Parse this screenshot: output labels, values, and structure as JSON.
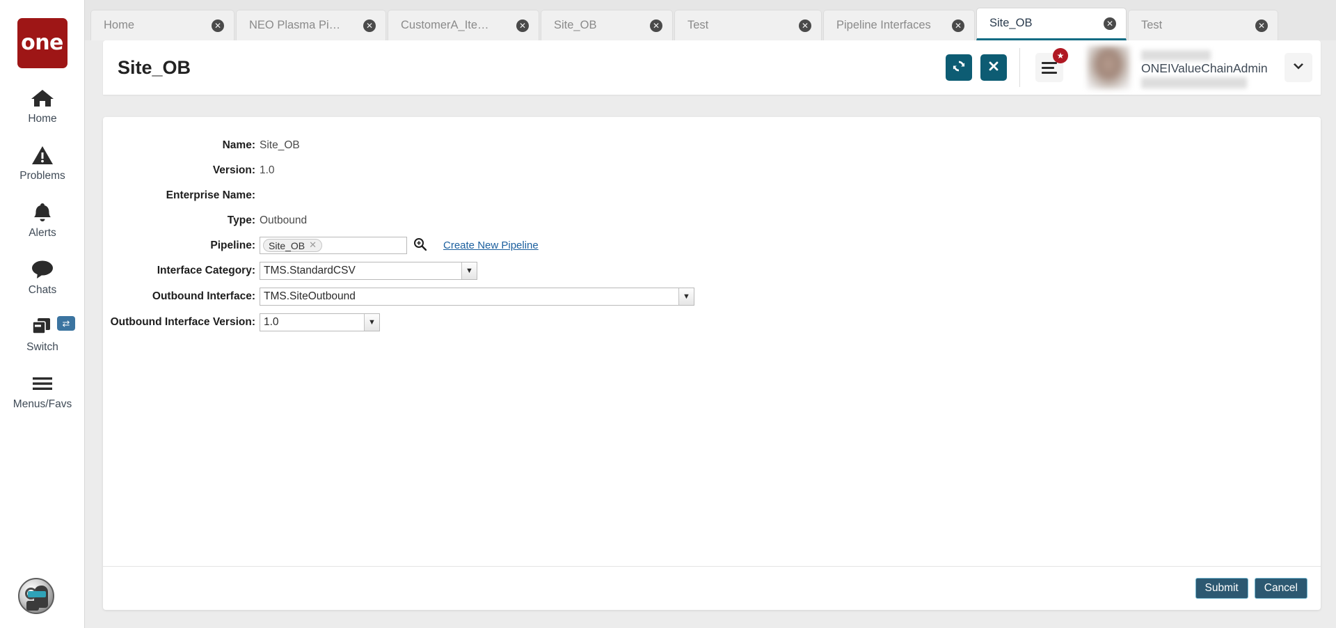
{
  "brand": {
    "logo_text": "one"
  },
  "sidebar": {
    "items": [
      {
        "label": "Home",
        "icon": "home-icon"
      },
      {
        "label": "Problems",
        "icon": "warning-triangle-icon"
      },
      {
        "label": "Alerts",
        "icon": "bell-icon"
      },
      {
        "label": "Chats",
        "icon": "chat-bubble-icon"
      },
      {
        "label": "Switch",
        "icon": "windows-stack-icon",
        "badge_icon": "swap-arrows-icon"
      },
      {
        "label": "Menus/Favs",
        "icon": "hamburger-icon"
      }
    ],
    "assistant_icon": "ai-assistant-orb-icon"
  },
  "tabs": [
    {
      "label": "Home",
      "active": false
    },
    {
      "label": "NEO Plasma Pipelines",
      "active": false
    },
    {
      "label": "CustomerA_Item_IB",
      "active": false
    },
    {
      "label": "Site_OB",
      "active": false
    },
    {
      "label": "Test",
      "active": false
    },
    {
      "label": "Pipeline Interfaces",
      "active": false
    },
    {
      "label": "Site_OB",
      "active": true
    },
    {
      "label": "Test",
      "active": false
    }
  ],
  "header": {
    "title": "Site_OB",
    "refresh_icon": "refresh-icon",
    "close_icon": "close-x-icon",
    "menu_icon": "hamburger-menu-icon",
    "favorite_badge_icon": "star-badge-icon",
    "avatar_icon": "user-avatar",
    "username": "ONEIValueChainAdmin",
    "chevron_icon": "chevron-down-icon"
  },
  "form": {
    "rows": [
      {
        "label": "Name:",
        "value": "Site_OB"
      },
      {
        "label": "Version:",
        "value": "1.0"
      },
      {
        "label": "Enterprise Name:",
        "value": ""
      },
      {
        "label": "Type:",
        "value": "Outbound"
      }
    ],
    "pipeline": {
      "label": "Pipeline:",
      "token": "Site_OB",
      "token_remove_icon": "remove-x-icon",
      "search_icon": "search-magnifier-icon",
      "link": "Create New Pipeline"
    },
    "interface_category": {
      "label": "Interface Category:",
      "value": "TMS.StandardCSV"
    },
    "outbound_interface": {
      "label": "Outbound Interface:",
      "value": "TMS.SiteOutbound"
    },
    "outbound_interface_version": {
      "label": "Outbound Interface Version:",
      "value": "1.0"
    }
  },
  "footer": {
    "submit_label": "Submit",
    "cancel_label": "Cancel"
  },
  "colors": {
    "brand_red": "#9e1616",
    "teal_button": "#0d5c73",
    "active_tab_underline": "#0f6b83",
    "footer_button": "#2c5871",
    "link_blue": "#1b5f9e"
  }
}
